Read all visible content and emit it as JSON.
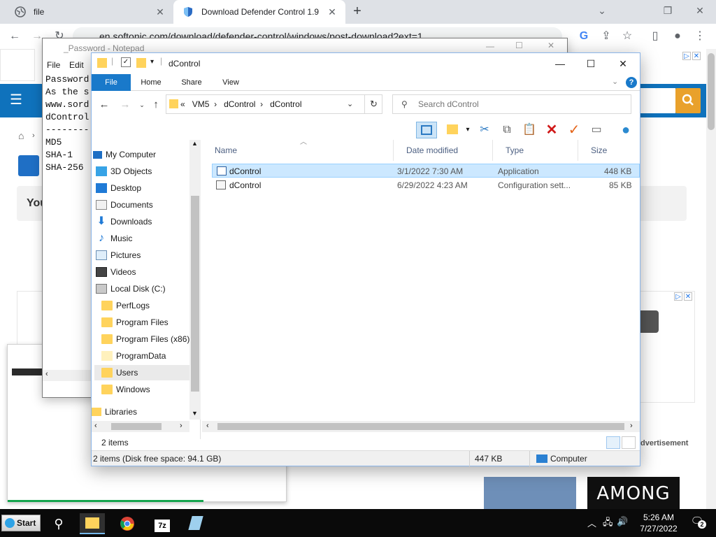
{
  "browser": {
    "tabs": [
      {
        "title": "file",
        "close": "✕"
      },
      {
        "title": "Download Defender Control 1.9",
        "close": "✕"
      }
    ],
    "new_tab": "+",
    "window_controls": {
      "minimize": "⌄",
      "restore": "❐",
      "close": "✕"
    },
    "url": "en.softonic.com/download/defender-control/windows/post-download?ext=1",
    "icons": [
      "back-icon",
      "forward-icon",
      "reload-icon",
      "google-icon",
      "share-icon",
      "star-icon",
      "sidepanel-icon",
      "profile-icon",
      "menu-icon"
    ]
  },
  "webpage": {
    "you_text": "You",
    "advertisement": "dvertisement",
    "among_us": "AMONG US",
    "ad_labels": [
      "▷",
      "✕"
    ]
  },
  "notepad": {
    "title": "_Password - Notepad",
    "menu": [
      "File",
      "Edit"
    ],
    "lines": [
      "Password",
      "",
      "As the s",
      "",
      "www.sord",
      "",
      "dControl",
      "--------",
      "MD5",
      "SHA-1",
      "SHA-256"
    ]
  },
  "explorer": {
    "title": "dControl",
    "window_controls": {
      "minimize": "—",
      "maximize": "☐",
      "close": "✕"
    },
    "ribbon_tabs": [
      "File",
      "Home",
      "Share",
      "View"
    ],
    "help": "?",
    "breadcrumb": {
      "prefix": "«",
      "parts": [
        "VM5",
        "dControl",
        "dControl"
      ],
      "sep": "›"
    },
    "search_placeholder": "Search dControl",
    "nav_items": [
      {
        "label": "My Computer",
        "icon": "computer-icon",
        "indent": 0
      },
      {
        "label": "3D Objects",
        "icon": "cube-icon",
        "indent": 1
      },
      {
        "label": "Desktop",
        "icon": "desktop-icon",
        "indent": 1
      },
      {
        "label": "Documents",
        "icon": "documents-icon",
        "indent": 1
      },
      {
        "label": "Downloads",
        "icon": "download-icon",
        "indent": 1
      },
      {
        "label": "Music",
        "icon": "music-icon",
        "indent": 1
      },
      {
        "label": "Pictures",
        "icon": "pictures-icon",
        "indent": 1
      },
      {
        "label": "Videos",
        "icon": "videos-icon",
        "indent": 1
      },
      {
        "label": "Local Disk (C:)",
        "icon": "drive-icon",
        "indent": 1
      },
      {
        "label": "PerfLogs",
        "icon": "folder-icon",
        "indent": 2
      },
      {
        "label": "Program Files",
        "icon": "folder-icon",
        "indent": 2
      },
      {
        "label": "Program Files (x86)",
        "icon": "folder-icon",
        "indent": 2
      },
      {
        "label": "ProgramData",
        "icon": "folder-icon",
        "indent": 2
      },
      {
        "label": "Users",
        "icon": "folder-icon",
        "indent": 2
      },
      {
        "label": "Windows",
        "icon": "folder-icon",
        "indent": 2
      },
      {
        "label": "Libraries",
        "icon": "libraries-icon",
        "indent": 0
      }
    ],
    "columns": [
      "Name",
      "Date modified",
      "Type",
      "Size"
    ],
    "files": [
      {
        "name": "dControl",
        "date": "3/1/2022 7:30 AM",
        "type": "Application",
        "size": "448 KB",
        "selected": true
      },
      {
        "name": "dControl",
        "date": "6/29/2022 4:23 AM",
        "type": "Configuration sett...",
        "size": "85 KB",
        "selected": false
      }
    ],
    "status_items": "2 items",
    "details_left": "2 items (Disk free space: 94.1 GB)",
    "details_size": "447 KB",
    "details_location": "Computer"
  },
  "taskbar": {
    "start": "Start",
    "seven_zip": "7z",
    "time": "5:26 AM",
    "date": "7/27/2022",
    "notifications": "2",
    "tray_icons": [
      "chevron-up-icon",
      "network-icon",
      "volume-icon"
    ]
  },
  "colors": {
    "accent": "#1979ca",
    "selection": "#cce8ff",
    "softonic_blue": "#0f72bc",
    "taskbar": "#0a0a0a"
  }
}
